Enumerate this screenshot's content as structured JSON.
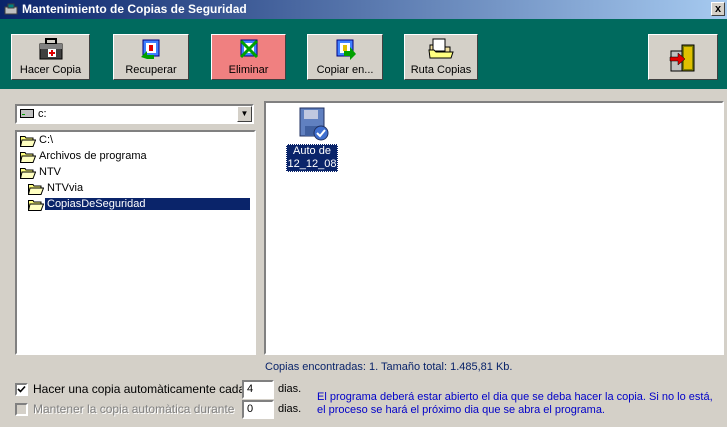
{
  "window": {
    "title": "Mantenimiento de Copias de Seguridad",
    "close_label": "x"
  },
  "toolbar": {
    "hacer_copia": "Hacer Copia",
    "recuperar": "Recuperar",
    "eliminar": "Eliminar",
    "copiar_en": "Copiar en...",
    "ruta_copias": "Ruta Copias"
  },
  "drive": {
    "value": "c:"
  },
  "tree": {
    "nodes": [
      "C:\\",
      "Archivos de programa",
      "NTV",
      "NTVvia",
      "CopiasDeSeguridad"
    ],
    "selected": "CopiasDeSeguridad"
  },
  "files": [
    {
      "label": "Auto de 12_12_08"
    }
  ],
  "summary": "Copias encontradas: 1. Tamaño total: 1.485,81 Kb.",
  "options": {
    "auto_copy": {
      "checked": true,
      "label": "Hacer una copia automàticamente cada",
      "value": "4",
      "unit": "dias."
    },
    "keep_copy": {
      "checked": false,
      "enabled": false,
      "label": "Mantener la copia automàtica durante",
      "value": "0",
      "unit": "dias."
    }
  },
  "note": "El programa deberá estar abierto el dia que se deba hacer la copia. Si no lo está, el proceso se hará el próximo dia que se abra el programa.",
  "colors": {
    "toolbar_bg": "#006a5e",
    "title_start": "#0a246a",
    "title_end": "#a6caf0",
    "selection": "#0a246a",
    "eliminar_bg": "#f08080",
    "note_text": "#0000c8"
  }
}
